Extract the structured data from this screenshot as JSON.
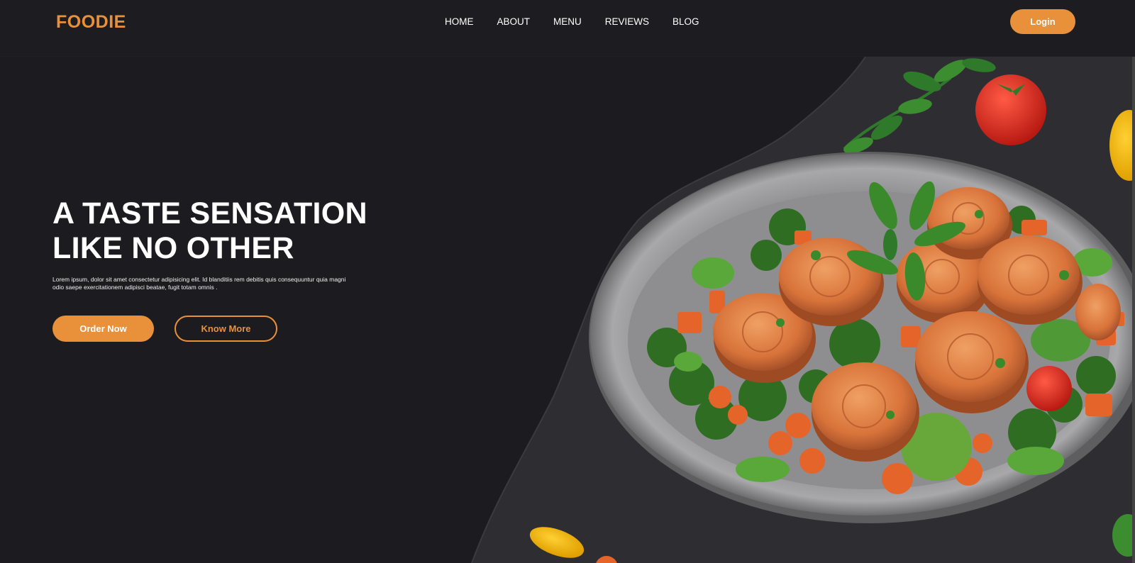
{
  "brand": {
    "name": "FOODIE"
  },
  "nav": {
    "items": [
      {
        "label": "HOME"
      },
      {
        "label": "ABOUT"
      },
      {
        "label": "MENU"
      },
      {
        "label": "REVIEWS"
      },
      {
        "label": "BLOG"
      }
    ],
    "login_label": "Login"
  },
  "hero": {
    "headline_line1": "A TASTE SENSATION",
    "headline_line2": "LIKE NO OTHER",
    "subtitle": "Lorem ipsum, dolor sit amet consectetur adipisicing elit. Id blanditiis rem debitis quis consequuntur quia magni odio saepe exercitationem adipisci beatae, fugit totam omnis .",
    "order_label": "Order Now",
    "know_label": "Know More"
  },
  "colors": {
    "accent": "#e8913a",
    "background": "#1c1c20",
    "surface": "#2e2e32"
  }
}
